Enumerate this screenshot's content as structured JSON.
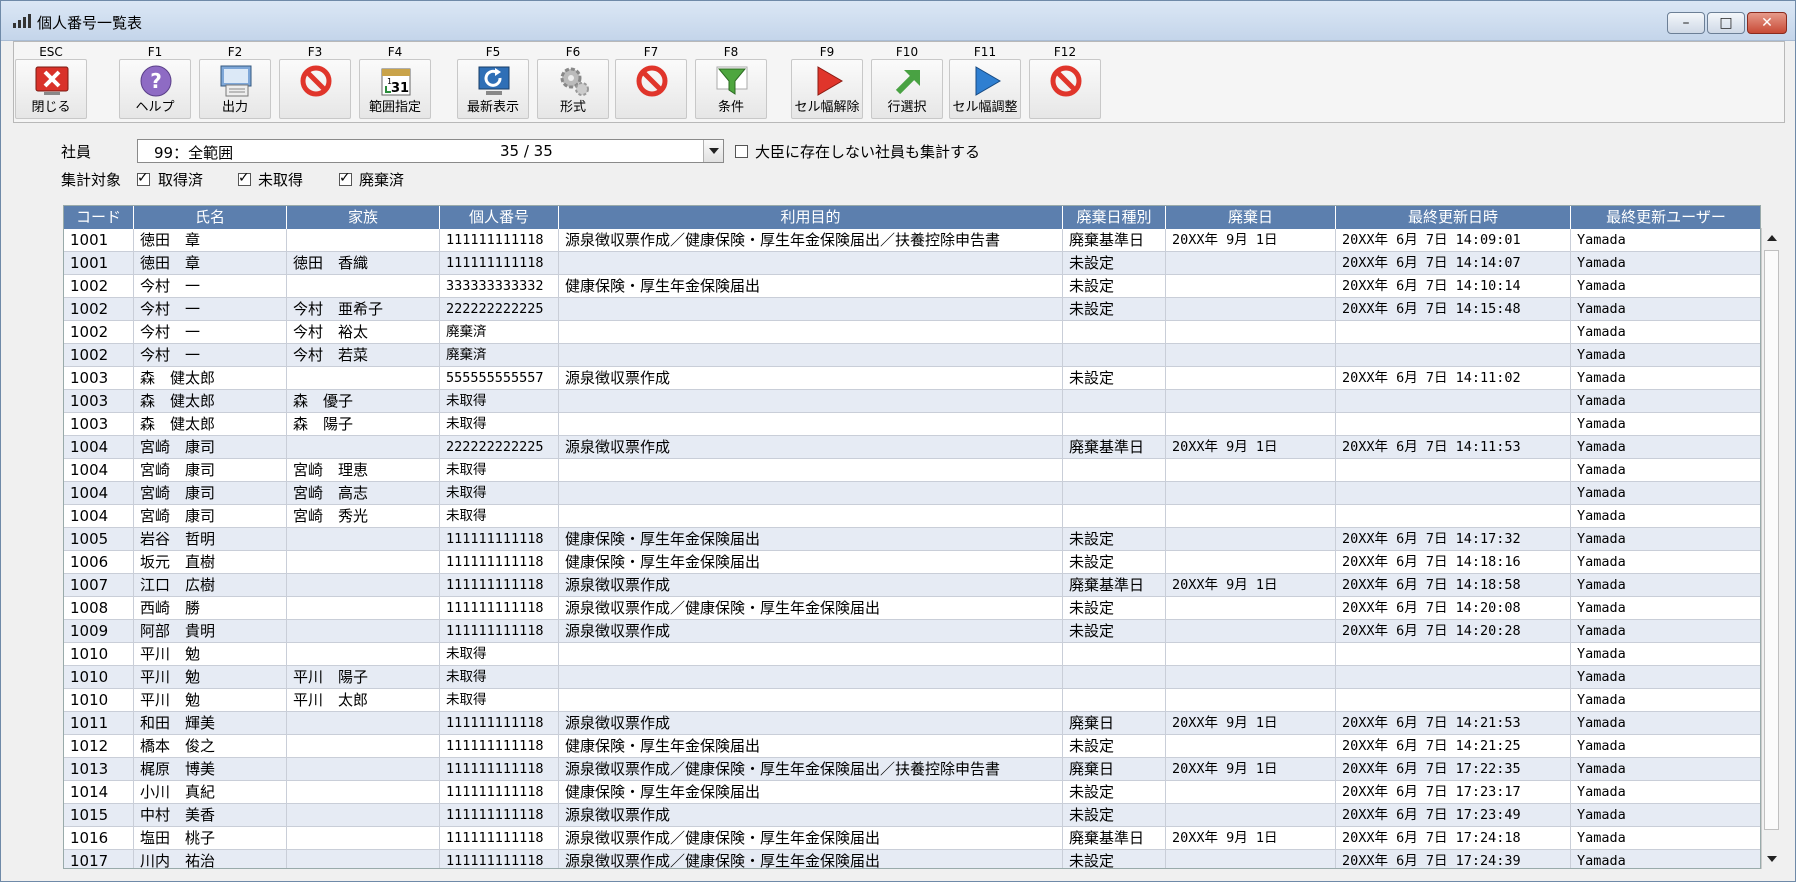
{
  "window": {
    "title": "個人番号一覧表"
  },
  "toolbar": [
    {
      "key": "ESC",
      "label": "閉じる",
      "icon": "close-icon"
    },
    {
      "key": "F1",
      "label": "ヘルプ",
      "icon": "help-icon"
    },
    {
      "key": "F2",
      "label": "出力",
      "icon": "output-icon"
    },
    {
      "key": "F3",
      "label": "",
      "icon": "disabled-icon"
    },
    {
      "key": "F4",
      "label": "範囲指定",
      "icon": "calendar-icon"
    },
    {
      "key": "F5",
      "label": "最新表示",
      "icon": "refresh-icon"
    },
    {
      "key": "F6",
      "label": "形式",
      "icon": "gear-icon"
    },
    {
      "key": "F7",
      "label": "",
      "icon": "disabled-icon"
    },
    {
      "key": "F8",
      "label": "条件",
      "icon": "filter-icon"
    },
    {
      "key": "F9",
      "label": "セル幅解除",
      "icon": "play-red-icon"
    },
    {
      "key": "F10",
      "label": "行選択",
      "icon": "arrow-up-right-icon"
    },
    {
      "key": "F11",
      "label": "セル幅調整",
      "icon": "play-blue-icon"
    },
    {
      "key": "F12",
      "label": "",
      "icon": "disabled-icon"
    }
  ],
  "filters": {
    "employee_label": "社員",
    "employee_value": "99：全範囲",
    "employee_count": "35 / 35",
    "include_missing_label": "大臣に存在しない社員も集計する",
    "include_missing": false,
    "target_label": "集計対象",
    "acquired_label": "取得済",
    "acquired": true,
    "not_acquired_label": "未取得",
    "not_acquired": true,
    "discarded_label": "廃棄済",
    "discarded": true
  },
  "grid": {
    "columns": [
      "コード",
      "氏名",
      "家族",
      "個人番号",
      "利用目的",
      "廃棄日種別",
      "廃棄日",
      "最終更新日時",
      "最終更新ユーザー"
    ],
    "rows": [
      [
        "1001",
        "徳田　章",
        "",
        "111111111118",
        "源泉徴収票作成／健康保険・厚生年金保険届出／扶養控除申告書",
        "廃棄基準日",
        "20XX年 9月 1日",
        "20XX年 6月 7日 14:09:01",
        "Yamada"
      ],
      [
        "1001",
        "徳田　章",
        "徳田　香織",
        "111111111118",
        "",
        "未設定",
        "",
        "20XX年 6月 7日 14:14:07",
        "Yamada"
      ],
      [
        "1002",
        "今村　一",
        "",
        "333333333332",
        "健康保険・厚生年金保険届出",
        "未設定",
        "",
        "20XX年 6月 7日 14:10:14",
        "Yamada"
      ],
      [
        "1002",
        "今村　一",
        "今村　亜希子",
        "222222222225",
        "",
        "未設定",
        "",
        "20XX年 6月 7日 14:15:48",
        "Yamada"
      ],
      [
        "1002",
        "今村　一",
        "今村　裕太",
        "廃棄済",
        "",
        "",
        "",
        "",
        "Yamada"
      ],
      [
        "1002",
        "今村　一",
        "今村　若菜",
        "廃棄済",
        "",
        "",
        "",
        "",
        "Yamada"
      ],
      [
        "1003",
        "森　健太郎",
        "",
        "555555555557",
        "源泉徴収票作成",
        "未設定",
        "",
        "20XX年 6月 7日 14:11:02",
        "Yamada"
      ],
      [
        "1003",
        "森　健太郎",
        "森　優子",
        "未取得",
        "",
        "",
        "",
        "",
        "Yamada"
      ],
      [
        "1003",
        "森　健太郎",
        "森　陽子",
        "未取得",
        "",
        "",
        "",
        "",
        "Yamada"
      ],
      [
        "1004",
        "宮崎　康司",
        "",
        "222222222225",
        "源泉徴収票作成",
        "廃棄基準日",
        "20XX年 9月 1日",
        "20XX年 6月 7日 14:11:53",
        "Yamada"
      ],
      [
        "1004",
        "宮崎　康司",
        "宮崎　理恵",
        "未取得",
        "",
        "",
        "",
        "",
        "Yamada"
      ],
      [
        "1004",
        "宮崎　康司",
        "宮崎　高志",
        "未取得",
        "",
        "",
        "",
        "",
        "Yamada"
      ],
      [
        "1004",
        "宮崎　康司",
        "宮崎　秀光",
        "未取得",
        "",
        "",
        "",
        "",
        "Yamada"
      ],
      [
        "1005",
        "岩谷　哲明",
        "",
        "111111111118",
        "健康保険・厚生年金保険届出",
        "未設定",
        "",
        "20XX年 6月 7日 14:17:32",
        "Yamada"
      ],
      [
        "1006",
        "坂元　直樹",
        "",
        "111111111118",
        "健康保険・厚生年金保険届出",
        "未設定",
        "",
        "20XX年 6月 7日 14:18:16",
        "Yamada"
      ],
      [
        "1007",
        "江口　広樹",
        "",
        "111111111118",
        "源泉徴収票作成",
        "廃棄基準日",
        "20XX年 9月 1日",
        "20XX年 6月 7日 14:18:58",
        "Yamada"
      ],
      [
        "1008",
        "西崎　勝",
        "",
        "111111111118",
        "源泉徴収票作成／健康保険・厚生年金保険届出",
        "未設定",
        "",
        "20XX年 6月 7日 14:20:08",
        "Yamada"
      ],
      [
        "1009",
        "阿部　貴明",
        "",
        "111111111118",
        "源泉徴収票作成",
        "未設定",
        "",
        "20XX年 6月 7日 14:20:28",
        "Yamada"
      ],
      [
        "1010",
        "平川　勉",
        "",
        "未取得",
        "",
        "",
        "",
        "",
        "Yamada"
      ],
      [
        "1010",
        "平川　勉",
        "平川　陽子",
        "未取得",
        "",
        "",
        "",
        "",
        "Yamada"
      ],
      [
        "1010",
        "平川　勉",
        "平川　太郎",
        "未取得",
        "",
        "",
        "",
        "",
        "Yamada"
      ],
      [
        "1011",
        "和田　輝美",
        "",
        "111111111118",
        "源泉徴収票作成",
        "廃棄日",
        "20XX年 9月 1日",
        "20XX年 6月 7日 14:21:53",
        "Yamada"
      ],
      [
        "1012",
        "橋本　俊之",
        "",
        "111111111118",
        "健康保険・厚生年金保険届出",
        "未設定",
        "",
        "20XX年 6月 7日 14:21:25",
        "Yamada"
      ],
      [
        "1013",
        "梶原　博美",
        "",
        "111111111118",
        "源泉徴収票作成／健康保険・厚生年金保険届出／扶養控除申告書",
        "廃棄日",
        "20XX年 9月 1日",
        "20XX年 6月 7日 17:22:35",
        "Yamada"
      ],
      [
        "1014",
        "小川　真紀",
        "",
        "111111111118",
        "健康保険・厚生年金保険届出",
        "未設定",
        "",
        "20XX年 6月 7日 17:23:17",
        "Yamada"
      ],
      [
        "1015",
        "中村　美香",
        "",
        "111111111118",
        "源泉徴収票作成",
        "未設定",
        "",
        "20XX年 6月 7日 17:23:49",
        "Yamada"
      ],
      [
        "1016",
        "塩田　桃子",
        "",
        "111111111118",
        "源泉徴収票作成／健康保険・厚生年金保険届出",
        "廃棄基準日",
        "20XX年 9月 1日",
        "20XX年 6月 7日 17:24:18",
        "Yamada"
      ],
      [
        "1017",
        "川内　祐治",
        "",
        "111111111118",
        "源泉徴収票作成／健康保険・厚生年金保険届出",
        "未設定",
        "",
        "20XX年 6月 7日 17:24:39",
        "Yamada"
      ]
    ]
  },
  "colors": {
    "header_bg": "#5c7fae",
    "row_alt": "#e6ebf4",
    "accent_red": "#d9322a"
  }
}
